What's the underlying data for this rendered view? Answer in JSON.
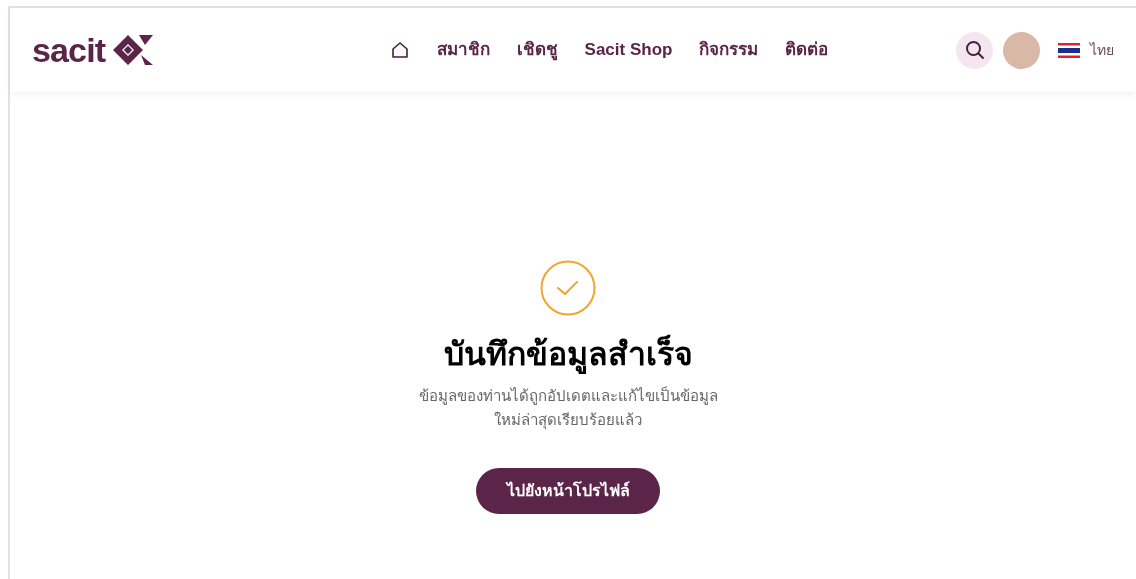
{
  "header": {
    "logo_text": "sacit",
    "nav": [
      {
        "kind": "home"
      },
      {
        "kind": "link",
        "label": "สมาชิก"
      },
      {
        "kind": "link",
        "label": "เชิดชู"
      },
      {
        "kind": "link",
        "label": "Sacit Shop"
      },
      {
        "kind": "link",
        "label": "กิจกรรม"
      },
      {
        "kind": "link",
        "label": "ติดต่อ"
      }
    ],
    "language": "ไทย"
  },
  "result": {
    "title": "บันทึกข้อมูลสำเร็จ",
    "message": "ข้อมูลของท่านได้ถูกอัปเดตและแก้ไขเป็นข้อมูล ใหม่ล่าสุดเรียบร้อยแล้ว",
    "button": "ไปยังหน้าโปรไฟล์"
  }
}
